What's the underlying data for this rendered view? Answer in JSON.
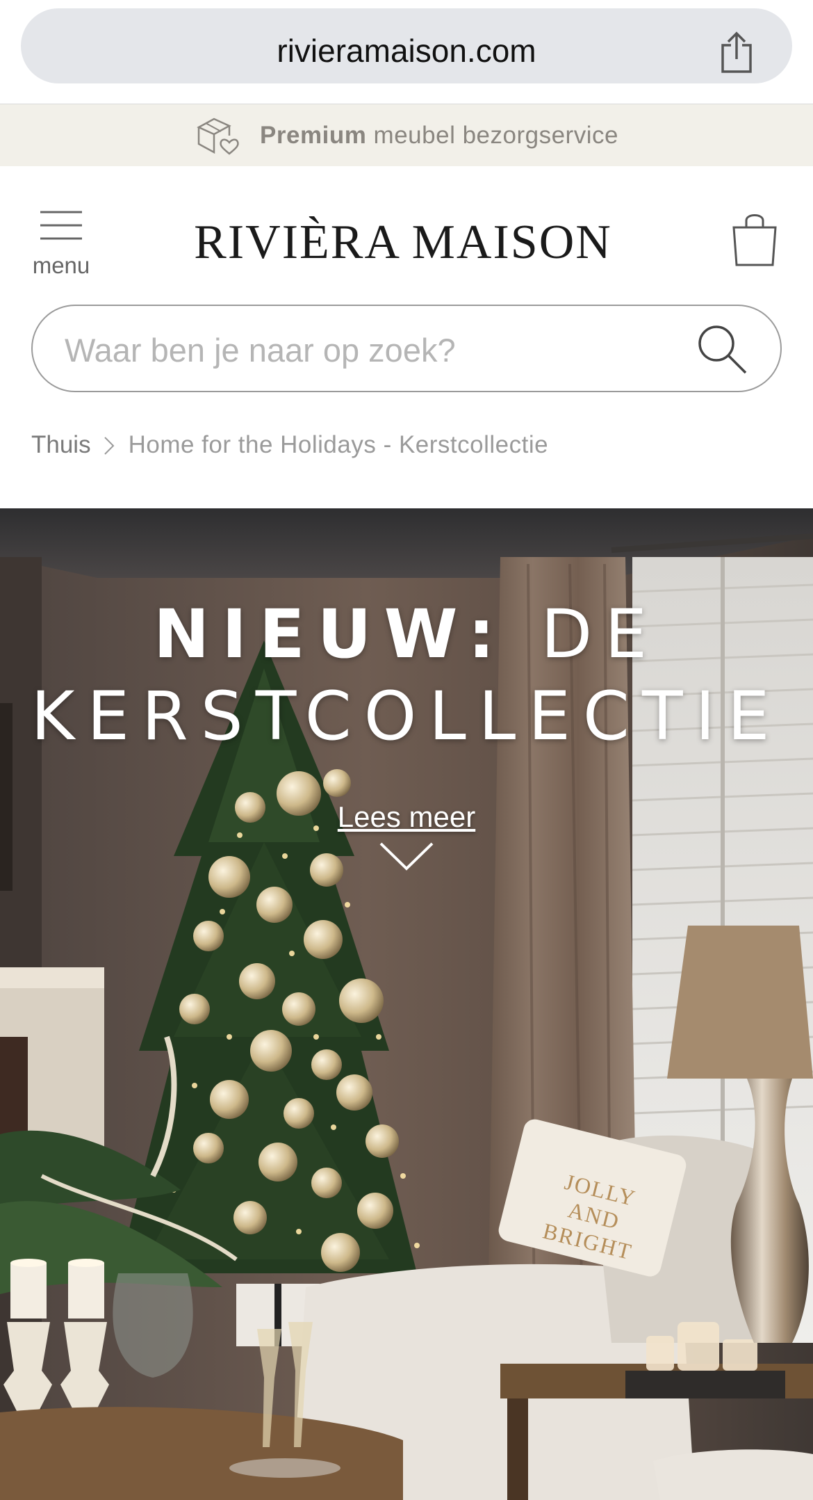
{
  "browser": {
    "url": "rivieramaison.com"
  },
  "promo": {
    "bold": "Premium",
    "rest": " meubel bezorgservice"
  },
  "header": {
    "logo": "RIVIÈRA MAISON",
    "menu_label": "menu"
  },
  "search": {
    "placeholder": "Waar ben je naar op zoek?"
  },
  "breadcrumb": {
    "home": "Thuis",
    "current": "Home for the Holidays - Kerstcollectie"
  },
  "hero": {
    "title_bold": "NIEUW:",
    "title_rest": " DE",
    "title_line2": "KERSTCOLLECTIE",
    "cta": "Lees meer",
    "pillow_text": [
      "JOLLY",
      "AND",
      "BRIGHT"
    ]
  },
  "colors": {
    "promo_bg": "#f2f0e9",
    "url_bar": "#e4e6ea",
    "hero_wall": "#6b5a50"
  }
}
